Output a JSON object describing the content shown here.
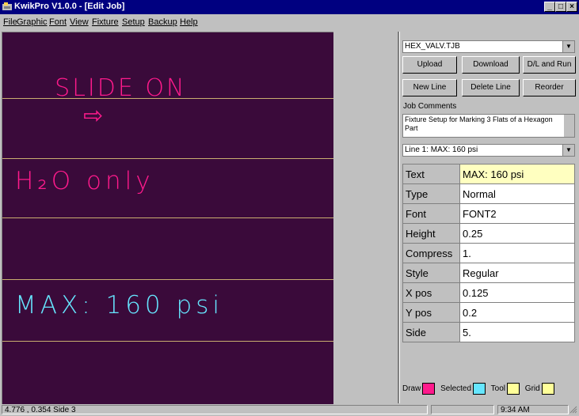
{
  "window": {
    "title": "KwikPro  V1.0.0 - [Edit Job]"
  },
  "menu": [
    "File",
    "Graphic",
    "Font",
    "View",
    "Fixture",
    "Setup",
    "Backup",
    "Help"
  ],
  "canvas": {
    "lines": [
      {
        "text": "SLIDE ON",
        "arrow": "⇨",
        "color": "#ff1a8c"
      },
      {
        "text": "H₂O only",
        "color": "#ff1a8c"
      },
      {
        "text": "MAX: 160 psi",
        "color": "#66e6ff"
      }
    ]
  },
  "panel": {
    "job_file": "HEX_VALV.TJB",
    "buttons": {
      "upload": "Upload",
      "download": "Download",
      "dl_run": "D/L and Run",
      "new_line": "New Line",
      "delete_line": "Delete Line",
      "reorder": "Reorder"
    },
    "comments_label": "Job Comments",
    "comments": "Fixture Setup for Marking 3 Flats of a Hexagon Part",
    "line_select": "Line 1: MAX: 160 psi",
    "props": [
      {
        "key": "Text",
        "value": "MAX: 160 psi"
      },
      {
        "key": "Type",
        "value": "Normal"
      },
      {
        "key": "Font",
        "value": "FONT2"
      },
      {
        "key": "Height",
        "value": "0.25"
      },
      {
        "key": "Compress",
        "value": "1."
      },
      {
        "key": "Style",
        "value": "Regular"
      },
      {
        "key": "X pos",
        "value": "0.125"
      },
      {
        "key": "Y pos",
        "value": "0.2"
      },
      {
        "key": "Side",
        "value": "5."
      }
    ],
    "legend": [
      {
        "label": "Draw",
        "color": "#ff1a8c"
      },
      {
        "label": "Selected",
        "color": "#66e6ff"
      },
      {
        "label": "Tool",
        "color": "#ffff99"
      },
      {
        "label": "Grid",
        "color": "#ffff99"
      }
    ]
  },
  "status": {
    "coords": "4.776 , 0.354 Side 3",
    "time": "9:34 AM"
  }
}
